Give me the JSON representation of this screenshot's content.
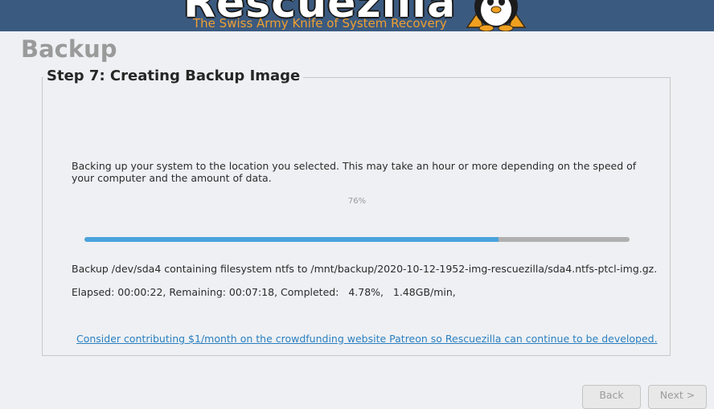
{
  "banner": {
    "logo_text": "Rescuezilla",
    "tagline": "The Swiss Army Knife of System Recovery",
    "mascot_icon": "penguin-mascot-icon"
  },
  "page": {
    "title": "Backup"
  },
  "step": {
    "title": "Step 7: Creating Backup Image",
    "description": "Backing up your system to the location you selected.  This may take an hour or more depending on the speed of your computer and the amount of data.",
    "progress_label": "76%",
    "progress_value": 0.76,
    "status_line": "Backup /dev/sda4 containing filesystem ntfs to /mnt/backup/2020-10-12-1952-img-rescuezilla/sda4.ntfs-ptcl-img.gz.",
    "time_line": "Elapsed: 00:00:22, Remaining: 00:07:18, Completed:   4.78%,   1.48GB/min,",
    "patreon_link": "Consider contributing $1/month on the crowdfunding website Patreon so Rescuezilla can continue to be developed."
  },
  "navigation": {
    "back_label": "Back",
    "next_label": "Next >"
  },
  "colors": {
    "banner": "#3b5a80",
    "accent": "#4aa3dc",
    "tagline": "#f0a030",
    "link": "#2a7fc0"
  }
}
